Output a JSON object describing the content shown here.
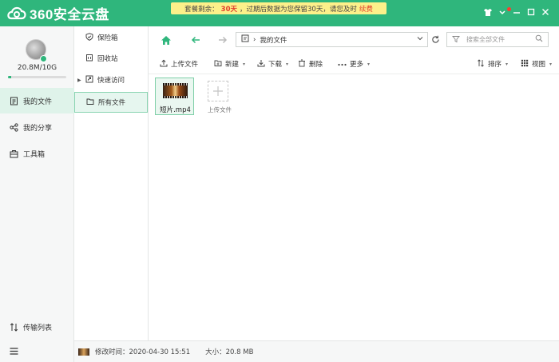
{
  "app": {
    "logo_text": "360安全云盘",
    "brand_color": "#2fb67c"
  },
  "notice": {
    "prefix": "套餐剩余：",
    "days": "30天",
    "message": "，过期后数据为您保留30天，请您及时",
    "action": "续费"
  },
  "account": {
    "quota": "20.8M/10G",
    "quota_used_fraction": 0.002
  },
  "nav": {
    "my_files": "我的文件",
    "my_shares": "我的分享",
    "toolbox": "工具箱",
    "transfer_list": "传输列表"
  },
  "tree": {
    "items": [
      {
        "label": "保险箱",
        "icon": "shield-icon"
      },
      {
        "label": "回收站",
        "icon": "trash-icon"
      },
      {
        "label": "快速访问",
        "icon": "quick-access-icon"
      },
      {
        "label": "所有文件",
        "icon": "folder-icon"
      }
    ]
  },
  "address": {
    "path": "我的文件",
    "search_placeholder": "搜索全部文件"
  },
  "toolbar": {
    "upload": "上传文件",
    "new": "新建",
    "download": "下载",
    "delete": "删除",
    "more": "更多",
    "sort": "排序",
    "view": "视图"
  },
  "files": [
    {
      "name": "短片.mp4",
      "type": "video"
    }
  ],
  "upload_card": {
    "label": "上传文件"
  },
  "status": {
    "modified": "修改时间：2020-04-30 15:51",
    "size": "大小：20.8 MB"
  }
}
